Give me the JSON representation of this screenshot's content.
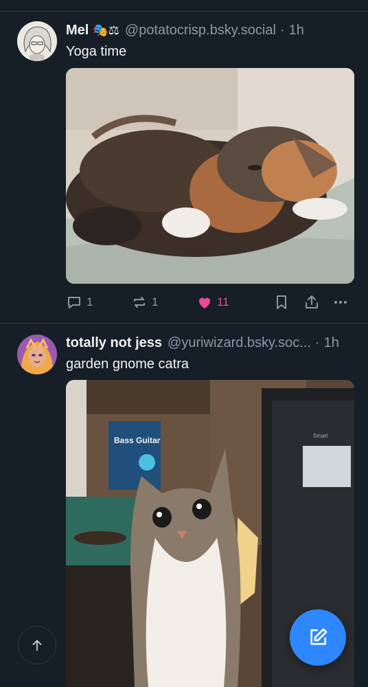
{
  "posts": [
    {
      "author_name": "Mel",
      "badges": "🎭⚖",
      "handle": "@potatocrisp.bsky.social",
      "separator": "·",
      "time": "1h",
      "text": "Yoga time",
      "image": "calico cat curled up sleeping on a blanket",
      "stats": {
        "replies": "1",
        "reposts": "1",
        "likes": "11"
      },
      "liked": true
    },
    {
      "author_name": "totally not jess",
      "handle": "@yuriwizard.bsky.soc...",
      "separator": "·",
      "time": "1h",
      "text": "garden gnome catra",
      "image": "tabby and white cat sitting between desk and speaker",
      "book_text": "Bass Guitar",
      "speaker_brand": "Smart"
    }
  ],
  "icons": {
    "reply": "reply-icon",
    "repost": "repost-icon",
    "like": "heart-icon",
    "bookmark": "bookmark-icon",
    "share": "share-icon",
    "more": "more-options-icon",
    "compose": "compose-icon",
    "scroll_top": "arrow-up-icon"
  },
  "colors": {
    "background": "#161e27",
    "accent": "#2f87ff",
    "like": "#ec4899",
    "muted": "#8b98a8"
  }
}
